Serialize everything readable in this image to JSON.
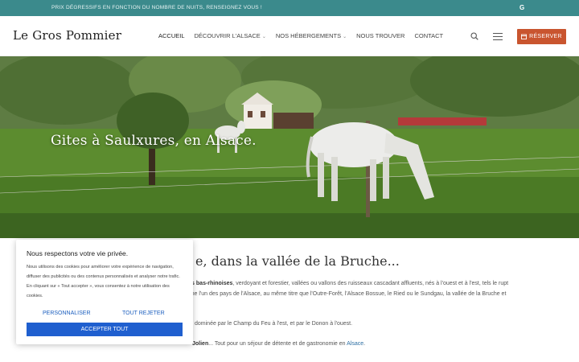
{
  "topbar": {
    "promo": "Prix dégressifs en fonction du nombre de nuits, renseignez vous !",
    "icon_letter": "G"
  },
  "header": {
    "logo": "Le Gros Pommier",
    "nav": [
      {
        "label": "Accueil",
        "dropdown": false
      },
      {
        "label": "Découvrir l'Alsace",
        "dropdown": true
      },
      {
        "label": "Nos hébergements",
        "dropdown": true
      },
      {
        "label": "Nous trouver",
        "dropdown": false
      },
      {
        "label": "Contact",
        "dropdown": false
      }
    ],
    "reserve_label": "Réserver"
  },
  "hero": {
    "title": "Gites à Saulxures, en Alsace."
  },
  "content": {
    "heading": "e,  dans la vallée de la Bruche...",
    "line1_bold": "ages bas-rhinoises",
    "line1_rest": ", verdoyant et forestier, vallées ou vallons des ruisseaux cascadant affluents, nés à l'ouest et à l'est, tels le rupt",
    "line2": "omme l'un des pays de l'Alsace, au même titre que l'Outre-Forêt, l'Alsace Bossue, le Ried ou le Sundgau, la vallée de la Bruche et",
    "line3": "dominée par le Champ du Feu à l'est, et par le Donon à l'ouest.",
    "line4_bold": "Jolien",
    "line4_rest": "... Tout pour un séjour de détente et de gastronomie en ",
    "line4_link": "Alsace",
    "line4_end": "."
  },
  "cookie": {
    "title": "Nous respectons votre vie privée.",
    "text": "Nous utilisons des cookies pour améliorer votre expérience de navigation, diffuser des publicités ou des contenus personnalisés et analyser notre trafic. En cliquant sur « Tout accepter », vous consentez à notre utilisation des cookies.",
    "customize_label": "Personnaliser",
    "reject_label": "Tout rejeter",
    "accept_label": "Accepter tout"
  },
  "colors": {
    "topbar": "#3b8a8c",
    "reserve": "#c9552f",
    "accept": "#1f5fcf",
    "link": "#1c5fbf"
  }
}
